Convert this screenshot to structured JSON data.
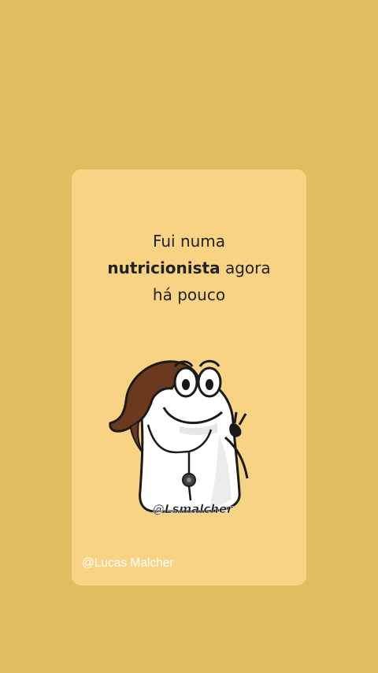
{
  "post": {
    "caption_line1": "Fui numa",
    "caption_bold": "nutricionista",
    "caption_after_bold": " agora",
    "caption_line3": "há pouco",
    "sticker_signature": "@Lsmalcher",
    "author_handle": "@Lucas Malcher"
  },
  "colors": {
    "background": "#e2bc60",
    "card": "#f7d383",
    "hair": "#6b3a1e",
    "outline": "#1a1a1a"
  },
  "icons": {
    "sticker": "doctor-character-sticker"
  }
}
